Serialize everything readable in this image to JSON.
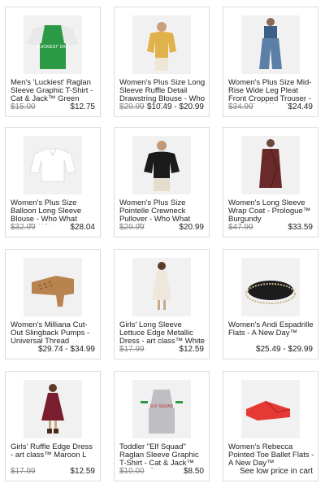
{
  "products": [
    {
      "title": "Men's 'Luckiest' Raglan Sleeve Graphic T-Shirt - Cat & Jack™ Green",
      "was": "$15.00",
      "now": "$12.75",
      "image": "green-tshirt-image"
    },
    {
      "title": "Women's Plus Size Long Sleeve Ruffle Detail Drawstring Blouse - Who What Wear™",
      "was": "$29.99",
      "now": "$10.49 - $20.99",
      "image": "yellow-blouse-image"
    },
    {
      "title": "Women's Plus Size Mid-Rise Wide Leg Pleat Front Cropped Trouser - Who What Wearâ...",
      "was": "$34.99",
      "now": "$24.49",
      "image": "blue-trouser-image"
    },
    {
      "title": "Women's Plus Size Balloon Long Sleeve Blouse - Who What Wear™ White",
      "was": "$32.99",
      "now": "$28.04",
      "image": "white-blouse-image"
    },
    {
      "title": "Women's Plus Size Pointelle Crewneck Pullover - Who What Wear™",
      "was": "$29.99",
      "now": "$20.99",
      "image": "black-pullover-image"
    },
    {
      "title": "Women's Long Sleeve Wrap Coat - Prologue™ Burgundy",
      "was": "$47.99",
      "now": "$33.59",
      "image": "burgundy-coat-image"
    },
    {
      "title": "Women's Milliana Cut-Out Slingback Pumps - Universal Thread",
      "was": "",
      "now": "$29.74 - $34.99",
      "image": "tan-pump-image"
    },
    {
      "title": "Girls' Long Sleeve Lettuce Edge Metallic Dress - art class™ White L",
      "was": "$17.99",
      "now": "$12.59",
      "image": "girls-dress-image"
    },
    {
      "title": "Women's Andi Espadrille Flats - A New Day™",
      "was": "",
      "now": "$25.49 - $29.99",
      "image": "black-espadrille-image"
    },
    {
      "title": "Girls' Ruffle Edge Dress - art class™ Maroon L",
      "was": "$17.99",
      "now": "$12.59",
      "image": "maroon-dress-image"
    },
    {
      "title": "Toddler \"Elf Squad\" Raglan Sleeve Graphic T-Shirt - Cat & Jack™ Heather Gra...",
      "was": "$10.00",
      "now": "$8.50",
      "image": "gray-elf-tee-image"
    },
    {
      "title": "Women's Rebecca Pointed Toe Ballet Flats - A New Day™",
      "was": "",
      "now": "See low price in cart",
      "image": "red-flat-image"
    }
  ],
  "graphics": {
    "luckiest_text": "'LUCKIEST' DAD",
    "elf_text": "ELF SQUAD"
  }
}
